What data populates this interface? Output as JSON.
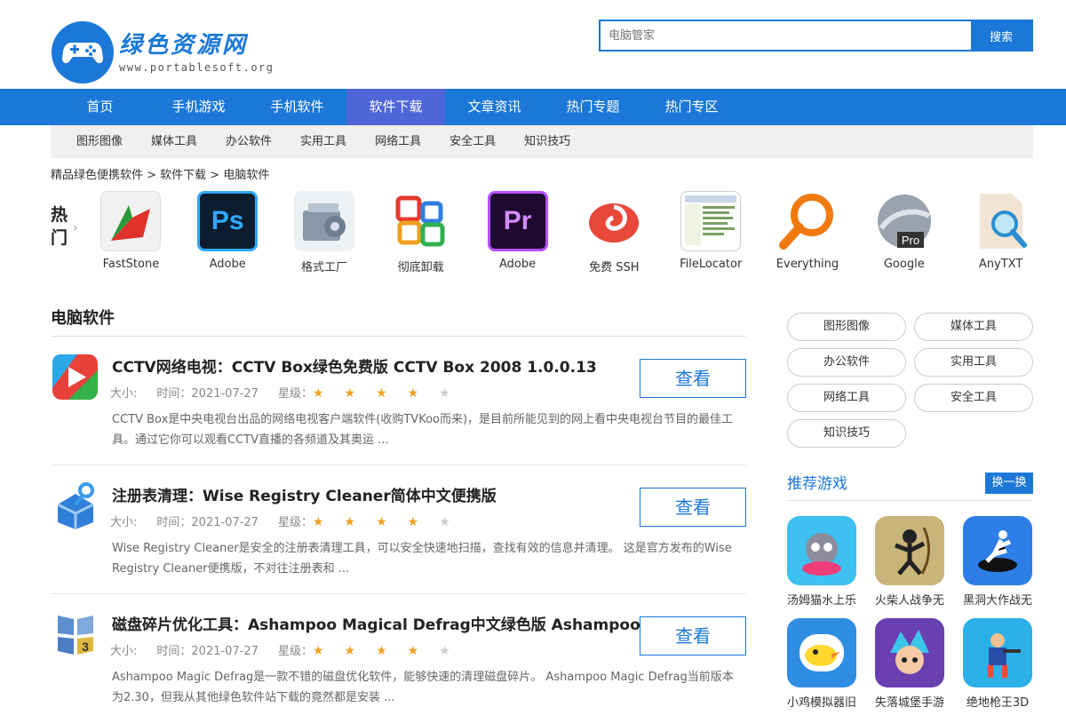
{
  "logo": {
    "title": "绿色资源网",
    "url": "www.portablesoft.org"
  },
  "search": {
    "placeholder": "电脑管家",
    "button": "搜索"
  },
  "nav": [
    "首页",
    "手机游戏",
    "手机软件",
    "软件下载",
    "文章资讯",
    "热门专题",
    "热门专区"
  ],
  "subnav": [
    "图形图像",
    "媒体工具",
    "办公软件",
    "实用工具",
    "网络工具",
    "安全工具",
    "知识技巧"
  ],
  "breadcrumb": "精品绿色便携软件 > 软件下载 > 电脑软件",
  "hot": {
    "label": "热门",
    "items": [
      {
        "name": "FastStone",
        "icon": "faststone-icon"
      },
      {
        "name": "Adobe",
        "icon": "photoshop-icon"
      },
      {
        "name": "格式工厂",
        "icon": "format-factory-icon"
      },
      {
        "name": "彻底卸载",
        "icon": "uninstall-icon"
      },
      {
        "name": "Adobe",
        "icon": "premiere-icon"
      },
      {
        "name": "免费 SSH",
        "icon": "ssh-icon"
      },
      {
        "name": "FileLocator",
        "icon": "filelocator-icon"
      },
      {
        "name": "Everything",
        "icon": "everything-icon"
      },
      {
        "name": "Google",
        "icon": "google-earth-icon"
      },
      {
        "name": "AnyTXT",
        "icon": "anytxt-icon"
      }
    ]
  },
  "main": {
    "section_title": "电脑软件",
    "articles": [
      {
        "title": "CCTV网络电视：CCTV Box绿色免费版 CCTV Box 2008 1.0.0.13",
        "size_label": "大小:",
        "time_label": "时间：",
        "date": "2021-07-27",
        "rating_label": "星级：",
        "rating": 4,
        "desc": "CCTV Box是中央电视台出品的网络电视客户端软件(收购TVKoo而来)，是目前所能见到的网上看中央电视台节目的最佳工具。通过它你可以观看CCTV直播的各频道及其奥运 ...",
        "button": "查看",
        "icon": "cctv-box-icon"
      },
      {
        "title": "注册表清理：Wise Registry Cleaner简体中文便携版",
        "size_label": "大小:",
        "time_label": "时间：",
        "date": "2021-07-27",
        "rating_label": "星级：",
        "rating": 4,
        "desc": "Wise Registry Cleaner是安全的注册表清理工具，可以安全快速地扫描，查找有效的信息并清理。 这是官方发布的Wise Registry Cleaner便携版，不对往注册表和 ...",
        "button": "查看",
        "icon": "wise-registry-icon"
      },
      {
        "title": "磁盘碎片优化工具：Ashampoo Magical Defrag中文绿色版 Ashampoo",
        "size_label": "大小:",
        "time_label": "时间：",
        "date": "2021-07-27",
        "rating_label": "星级：",
        "rating": 4,
        "desc": "Ashampoo Magic Defrag是一款不错的磁盘优化软件，能够快速的清理磁盘碎片。 Ashampoo Magic Defrag当前版本为2.30，但我从其他绿色软件站下载的竟然都是安装 ...",
        "button": "查看",
        "icon": "ashampoo-defrag-icon"
      }
    ]
  },
  "sidebar": {
    "tags": [
      "图形图像",
      "媒体工具",
      "办公软件",
      "实用工具",
      "网络工具",
      "安全工具",
      "知识技巧"
    ],
    "rec_title": "推荐游戏",
    "rec_swap": "换一换",
    "games": [
      {
        "name": "汤姆猫水上乐",
        "color": "#3ec0f0",
        "icon": "tom-cat-icon"
      },
      {
        "name": "火柴人战争无",
        "color": "#c9b57a",
        "icon": "stickman-icon"
      },
      {
        "name": "黑洞大作战无",
        "color": "#2d7ee6",
        "icon": "black-hole-icon"
      },
      {
        "name": "小鸡模拟器旧",
        "color": "#2f8de4",
        "icon": "chicken-icon"
      },
      {
        "name": "失落城堡手游",
        "color": "#6a3fb0",
        "icon": "lost-castle-icon"
      },
      {
        "name": "绝地枪王3D",
        "color": "#2bb0e8",
        "icon": "gun-king-icon"
      }
    ]
  },
  "colors": {
    "primary": "#1b78d8",
    "nav_active": "#4f66d8",
    "star": "#f5a020"
  }
}
